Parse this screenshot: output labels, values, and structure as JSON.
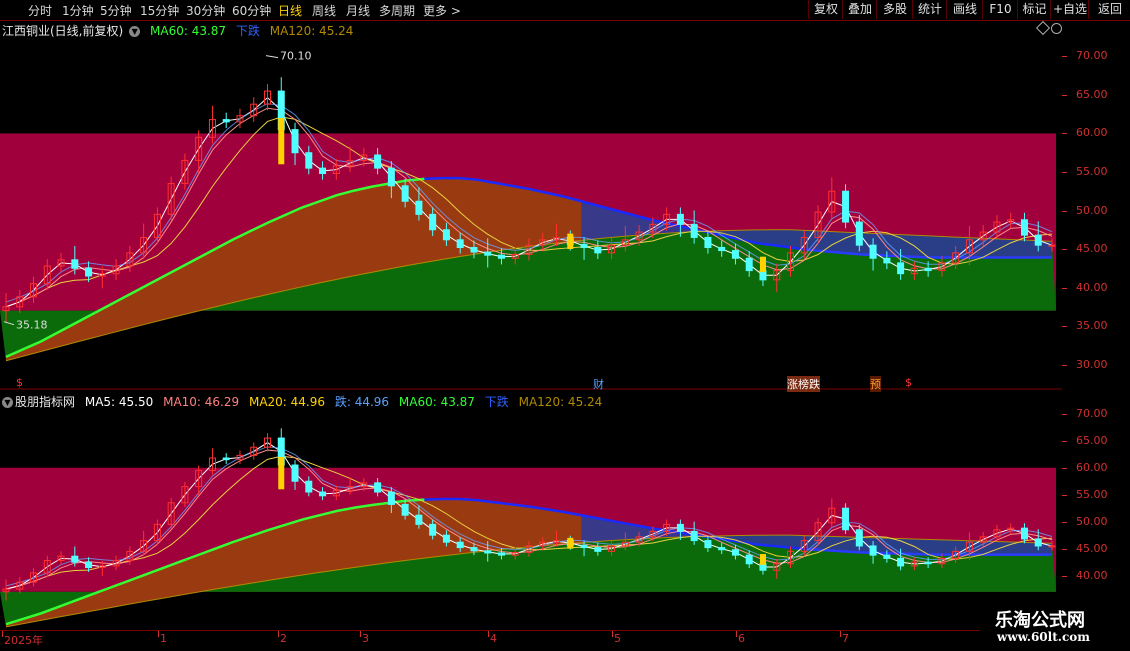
{
  "toolbar": {
    "periods": [
      "分时",
      "1分钟",
      "5分钟",
      "15分钟",
      "30分钟",
      "60分钟",
      "日线",
      "周线",
      "月线",
      "多周期",
      "更多 >"
    ],
    "active_period": "日线",
    "right_buttons": [
      "复权",
      "叠加",
      "多股",
      "统计",
      "画线",
      "F10",
      "标记",
      "+自选",
      "返回"
    ]
  },
  "main_panel": {
    "stock_title": "江西铜业(日线,前复权)",
    "ma60_label": "MA60: 43.87",
    "trend_label": "下跌",
    "ma120_label": "MA120: 45.24",
    "high_label": "70.10",
    "low_label": "35.18",
    "y_ticks": [
      "70.00",
      "65.00",
      "60.00",
      "55.00",
      "50.00",
      "45.00",
      "40.00",
      "35.00",
      "30.00"
    ]
  },
  "events": [
    {
      "text": "$",
      "color": "#ff3030"
    },
    {
      "text": "财",
      "color": "#5aa0ff"
    },
    {
      "text": "涨榜跌",
      "color": "#ffffff"
    },
    {
      "text": "预",
      "color": "#ff9a30"
    },
    {
      "text": "$",
      "color": "#ff3030"
    }
  ],
  "sub_panel": {
    "indicator_title": "股朋指标网",
    "ma5": "MA5: 45.50",
    "ma10": "MA10: 46.29",
    "ma20": "MA20: 44.96",
    "die": "跌: 44.96",
    "ma60": "MA60: 43.87",
    "trend": "下跌",
    "ma120": "MA120: 45.24",
    "y_ticks": [
      "70.00",
      "65.00",
      "60.00",
      "55.00",
      "50.00",
      "45.00",
      "40.00"
    ]
  },
  "date_axis": [
    "2025年",
    "1",
    "2",
    "3",
    "4",
    "5",
    "6",
    "7"
  ],
  "watermark": {
    "line1": "乐淘公式网",
    "line2": "www.60lt.com"
  },
  "colors": {
    "zone_top": "#a0003c",
    "zone_orange": "#9a3a10",
    "zone_green": "#0b6b0b",
    "zone_blue": "#2e3a96",
    "ma60_green": "#33ff33",
    "ma60_blue": "#1a2aff",
    "candle_up": "#ff3030",
    "candle_down": "#50ffff",
    "accent_yellow": "#ffd200"
  },
  "chart_data": {
    "type": "candlestick",
    "title": "江西铜业(日线,前复权)",
    "ylim": [
      28,
      72
    ],
    "x_months": [
      "2025年",
      "1",
      "2",
      "3",
      "4",
      "5",
      "6",
      "7"
    ],
    "closes": [
      37.5,
      38.8,
      40.5,
      42.8,
      43.6,
      42.5,
      41.5,
      41.8,
      42.8,
      44.5,
      46.5,
      49.5,
      53.5,
      56.5,
      59.5,
      61.8,
      61.5,
      62.3,
      63.8,
      65.5,
      60.5,
      57.5,
      55.5,
      54.8,
      55.8,
      56.5,
      57.2,
      55.5,
      53.2,
      51.2,
      49.5,
      47.5,
      46.2,
      45.2,
      44.6,
      44.2,
      43.8,
      44.3,
      45.5,
      46.2,
      46.5,
      45.6,
      45.2,
      44.5,
      45.5,
      46.2,
      47.2,
      48.2,
      49.5,
      48.2,
      46.5,
      45.2,
      44.8,
      43.8,
      42.2,
      41.0,
      42.2,
      44.5,
      46.5,
      49.8,
      52.5,
      48.5,
      45.5,
      43.8,
      43.2,
      41.8,
      42.5,
      42.2,
      43.2,
      44.5,
      46.2,
      47.2,
      48.5,
      48.8,
      46.8,
      45.5,
      45.5
    ],
    "ma60": [
      31,
      32,
      33,
      34.2,
      35.4,
      36.6,
      37.8,
      39,
      40.2,
      41.4,
      42.6,
      43.8,
      45,
      46.2,
      47.3,
      48.4,
      49.4,
      50.4,
      51.2,
      52,
      52.6,
      53.1,
      53.5,
      53.9,
      54.1,
      54.2,
      54.2,
      54.0,
      53.6,
      53.2,
      52.8,
      52.3,
      51.8,
      51.2,
      50.6,
      50.0,
      49.4,
      48.8,
      48.3,
      47.8,
      47.3,
      46.8,
      46.3,
      45.8,
      45.5,
      45.2,
      44.9,
      44.7,
      44.5,
      44.3,
      44.2,
      44.1,
      44.0,
      43.9,
      43.9,
      43.9,
      43.9,
      43.9,
      43.9,
      43.9,
      43.9
    ]
  }
}
